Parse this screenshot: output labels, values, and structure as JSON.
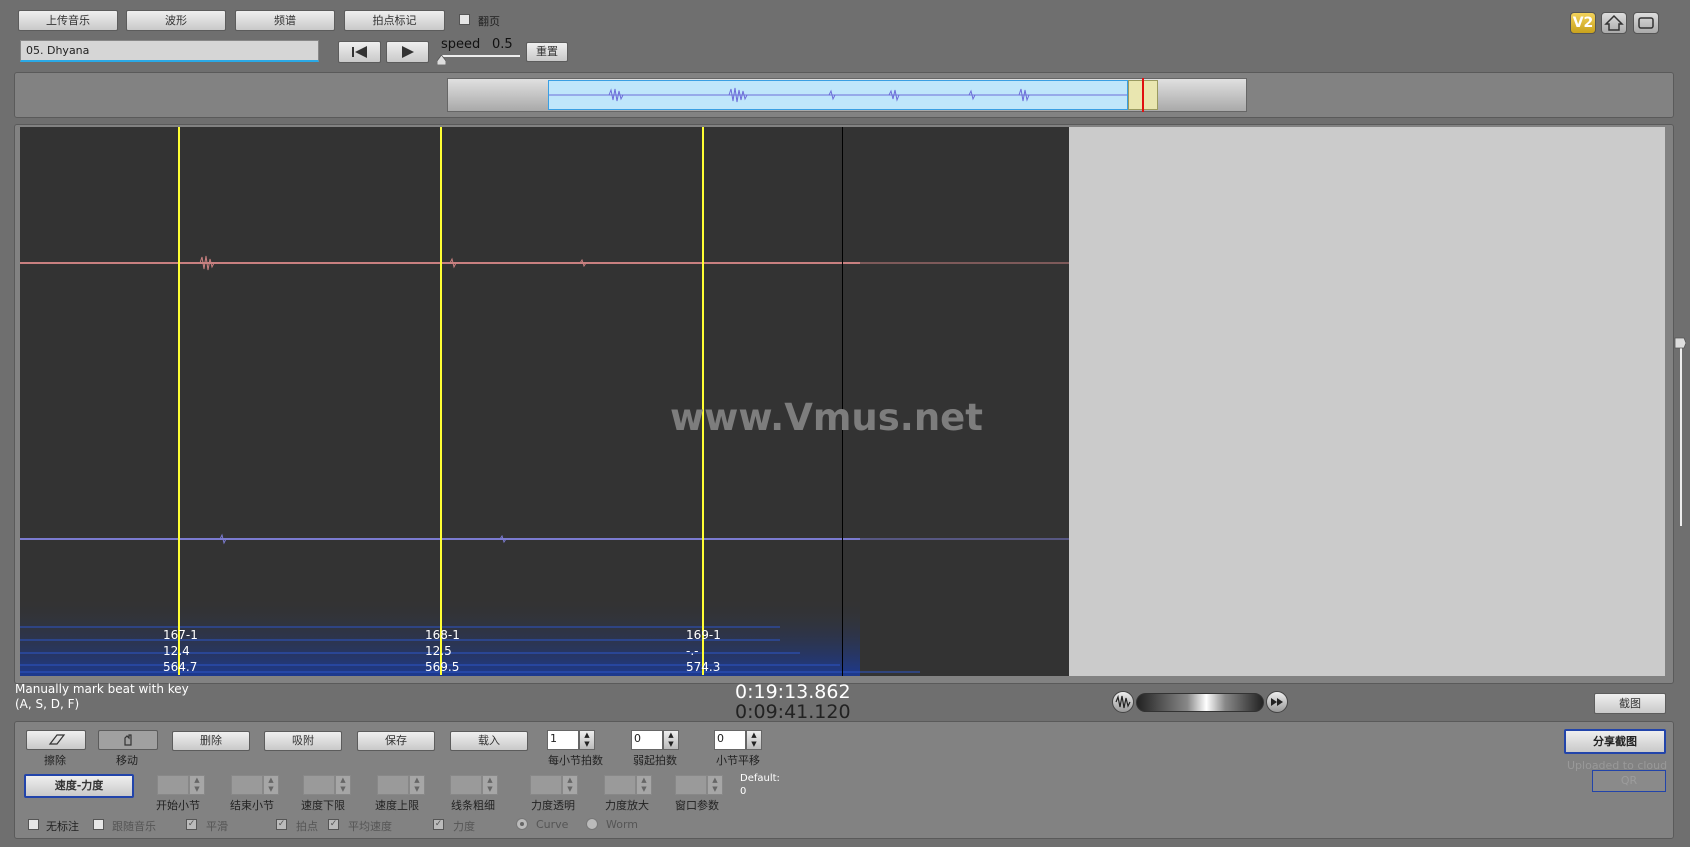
{
  "toolbar": {
    "upload": "上传音乐",
    "waveform": "波形",
    "spectrum": "频谱",
    "beat_mark": "拍点标记",
    "page_turn": "翻页"
  },
  "track_name": "05. Dhyana",
  "speed": {
    "label": "speed",
    "value": "0.5",
    "reset": "重置"
  },
  "logo": "V2",
  "watermark": "www.Vmus.net",
  "markers": [
    {
      "label": "167-1",
      "tempo": "12.4",
      "time": "564.7"
    },
    {
      "label": "168-1",
      "tempo": "12.5",
      "time": "569.5"
    },
    {
      "label": "169-1",
      "tempo": "-.-",
      "time": "574.3"
    }
  ],
  "hint": {
    "line1": "Manually mark beat with key",
    "line2": "(A, S, D, F)"
  },
  "time": {
    "total": "0:19:13.862",
    "current": "0:09:41.120"
  },
  "screenshot": "截图",
  "tools": {
    "erase_label": "擦除",
    "move_label": "移动",
    "delete": "删除",
    "snap": "吸附",
    "save": "保存",
    "load": "载入",
    "beats_per_bar": {
      "label": "每小节拍数",
      "value": "1"
    },
    "pickup_beats": {
      "label": "弱起拍数",
      "value": "0"
    },
    "bar_shift": {
      "label": "小节平移",
      "value": "0"
    }
  },
  "mode_button": "速度-力度",
  "params": {
    "start_bar": "开始小节",
    "end_bar": "结束小节",
    "tempo_min": "速度下限",
    "tempo_max": "速度上限",
    "line_width": "线条粗细",
    "dyn_transparency": "力度透明",
    "dyn_zoom": "力度放大",
    "window_param": "窗口参数",
    "default_label": "Default:",
    "default_value": "0"
  },
  "options": {
    "no_annotation": "无标注",
    "follow_music": "跟随音乐",
    "smooth": "平滑",
    "beats": "拍点",
    "avg_tempo": "平均速度",
    "dynamics": "力度",
    "curve": "Curve",
    "worm": "Worm"
  },
  "share": {
    "button": "分享截图",
    "status": "Uploaded to cloud",
    "sub_button": "QR"
  },
  "colors": {
    "accent": "#2244aa",
    "marker": "#ffff33",
    "wave_top": "#c98080",
    "wave_bottom": "#7b7bd0"
  }
}
